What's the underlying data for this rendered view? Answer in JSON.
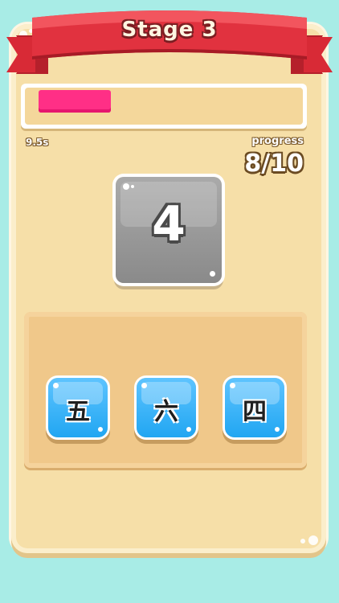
{
  "header": {
    "title": "Stage 3"
  },
  "timer": {
    "label": "9.5s",
    "fraction_remaining": 0.28
  },
  "progress": {
    "label": "progress",
    "value": "8/10"
  },
  "question": {
    "value": "4"
  },
  "answers": [
    {
      "label": "五"
    },
    {
      "label": "六"
    },
    {
      "label": "四"
    }
  ],
  "colors": {
    "background": "#a8ece6",
    "card": "#f6dfa8",
    "ribbon": "#e1323f",
    "timer_fill": "#ff2f86",
    "question_tile": "#999999",
    "answer_button": "#2fb1f7"
  }
}
